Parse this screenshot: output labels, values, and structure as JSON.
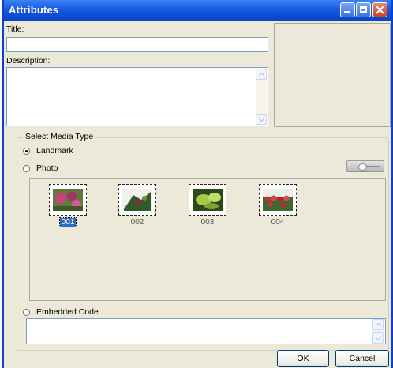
{
  "window": {
    "title": "Attributes"
  },
  "form": {
    "title_label": "Title:",
    "title_value": "",
    "description_label": "Description:",
    "description_value": ""
  },
  "media": {
    "group_label": "Select Media Type",
    "options": [
      {
        "label": "Landmark",
        "checked": true
      },
      {
        "label": "Photo",
        "checked": false
      },
      {
        "label": "Embedded Code",
        "checked": false
      }
    ],
    "thumbnails": [
      {
        "label": "001",
        "selected": true
      },
      {
        "label": "002",
        "selected": false
      },
      {
        "label": "003",
        "selected": false
      },
      {
        "label": "004",
        "selected": false
      }
    ],
    "embedded_code_value": ""
  },
  "buttons": {
    "ok": "OK",
    "cancel": "Cancel"
  }
}
